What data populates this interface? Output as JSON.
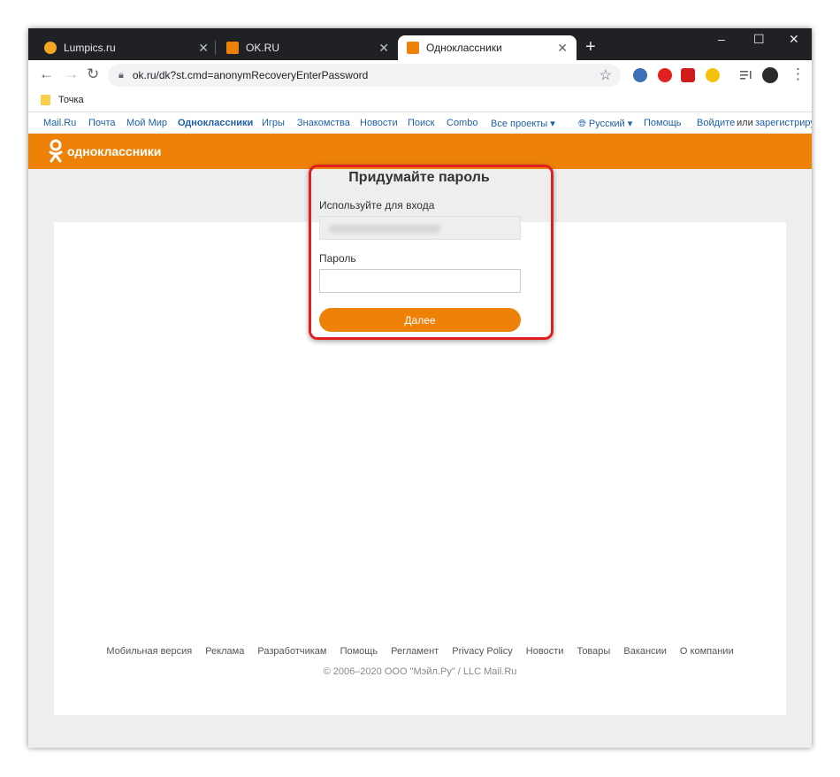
{
  "tabs": [
    {
      "title": "Lumpics.ru",
      "favicon_color": "#f5a623"
    },
    {
      "title": "OK.RU",
      "favicon_color": "#ee8208"
    },
    {
      "title": "Одноклассники",
      "favicon_color": "#ee8208",
      "active": true
    }
  ],
  "window_controls": {
    "minimize": "–",
    "maximize": "☐",
    "close": "✕"
  },
  "toolbar": {
    "url": "ok.ru/dk?st.cmd=anonymRecoveryEnterPassword"
  },
  "bookmarks": [
    {
      "label": "Точка"
    }
  ],
  "portal_nav": {
    "items": [
      "Mail.Ru",
      "Почта",
      "Мой Мир",
      "Одноклассники",
      "Игры",
      "Знакомства",
      "Новости",
      "Поиск",
      "Combo",
      "Все проекты"
    ],
    "language": "Русский",
    "help": "Помощь",
    "login": "Войдите",
    "or": "или",
    "register": "зарегистрируйтесь"
  },
  "header": {
    "logo_text": "одноклассники"
  },
  "form": {
    "title": "Придумайте пароль",
    "login_label": "Используйте для входа",
    "password_label": "Пароль",
    "next_button": "Далее"
  },
  "footer": {
    "links": [
      "Мобильная версия",
      "Реклама",
      "Разработчикам",
      "Помощь",
      "Регламент",
      "Privacy Policy",
      "Новости",
      "Товары",
      "Вакансии",
      "О компании"
    ],
    "copyright": "© 2006–2020 ООО \"Мэйл.Ру\" / LLC Mail.Ru"
  },
  "colors": {
    "accent": "#ee8208",
    "highlight": "#e02020",
    "link": "#1d5fa8"
  }
}
